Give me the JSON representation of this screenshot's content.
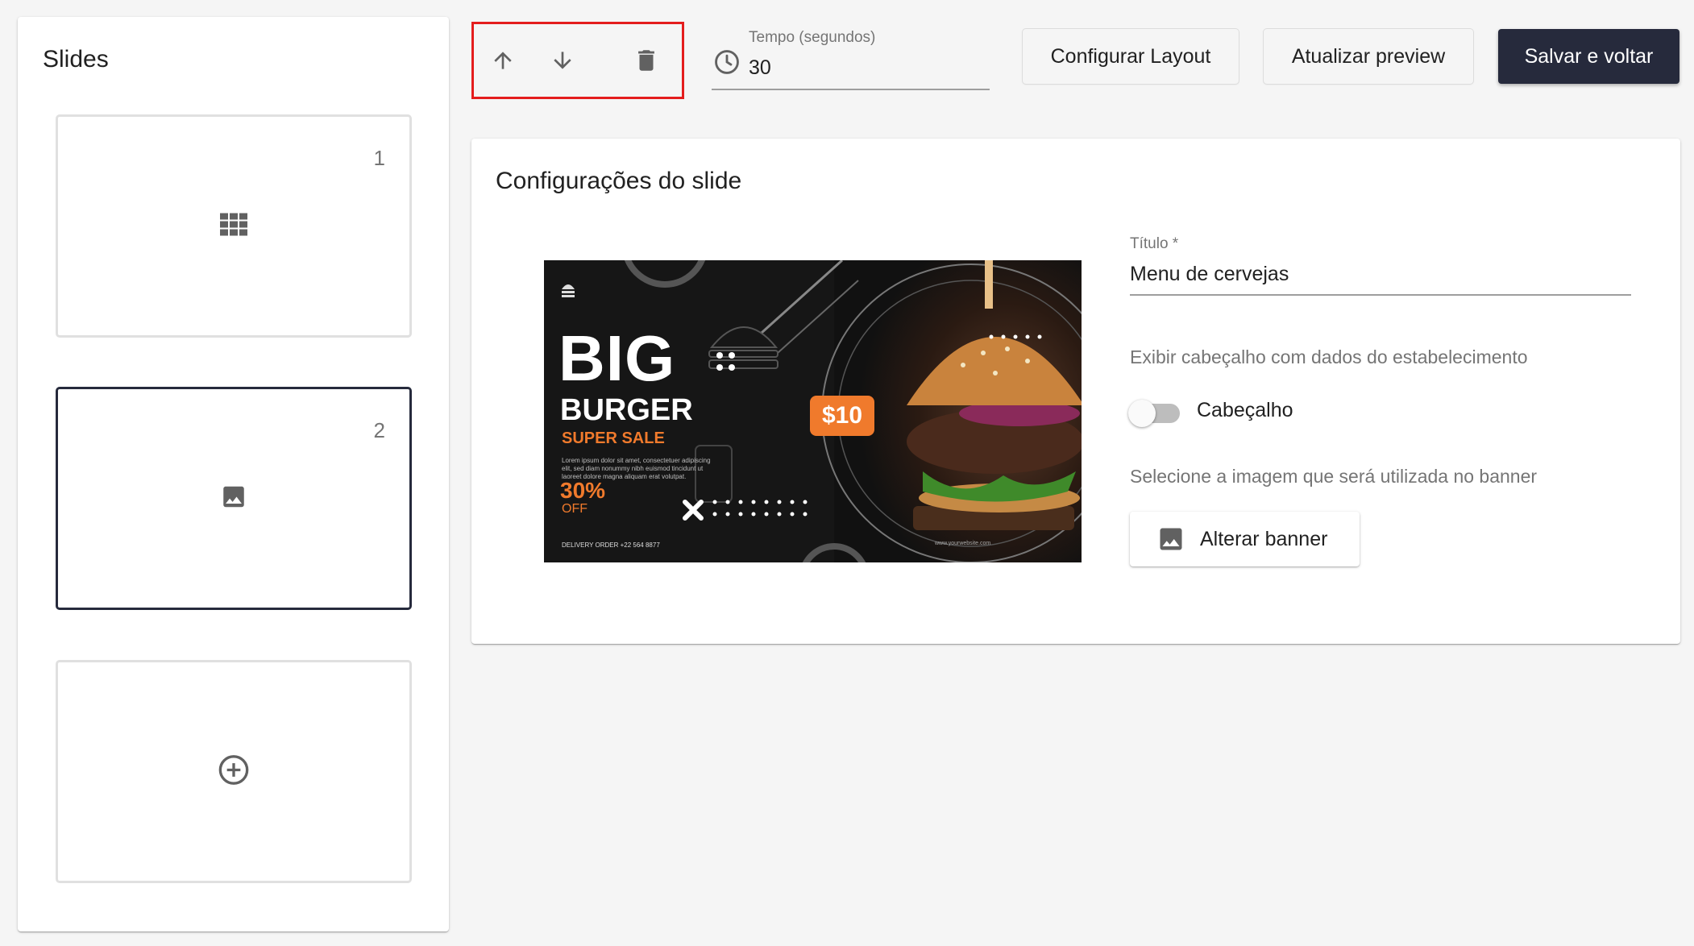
{
  "sidebar": {
    "title": "Slides",
    "slides": [
      {
        "number": "1",
        "icon": "grid-icon"
      },
      {
        "number": "2",
        "icon": "image-icon",
        "selected": true
      }
    ],
    "add_icon": "add-circle-icon"
  },
  "toolbar": {
    "icons": [
      "arrow-up-icon",
      "arrow-down-icon",
      "delete-icon"
    ],
    "time": {
      "label": "Tempo (segundos)",
      "value": "30",
      "icon": "clock-icon"
    },
    "configure_layout_label": "Configurar Layout",
    "refresh_preview_label": "Atualizar preview",
    "save_label": "Salvar e voltar"
  },
  "config": {
    "title": "Configurações do slide",
    "banner": {
      "big": "BIG",
      "burger": "BURGER",
      "super_sale": "SUPER SALE",
      "lorem": "Lorem ipsum dolor sit amet, consectetuer adipiscing elit, sed diam nonummy nibh euismod tincidunt ut laoreet dolore magna aliquam erat volutpat.",
      "percent": "30%",
      "off": "OFF",
      "delivery": "DELIVERY ORDER +22 564 8877",
      "price": "$10",
      "website": "www.yourwebsite.com"
    },
    "title_field": {
      "label": "Título *",
      "value": "Menu de cervejas"
    },
    "header_helper": "Exibir cabeçalho com dados do estabelecimento",
    "header_toggle": {
      "label": "Cabeçalho",
      "on": false
    },
    "banner_helper": "Selecione a imagem que será utilizada no banner",
    "change_banner_label": "Alterar banner"
  },
  "colors": {
    "primary": "#262a3c",
    "highlight_border": "#e41d1d",
    "accent_orange": "#f07a2c"
  }
}
